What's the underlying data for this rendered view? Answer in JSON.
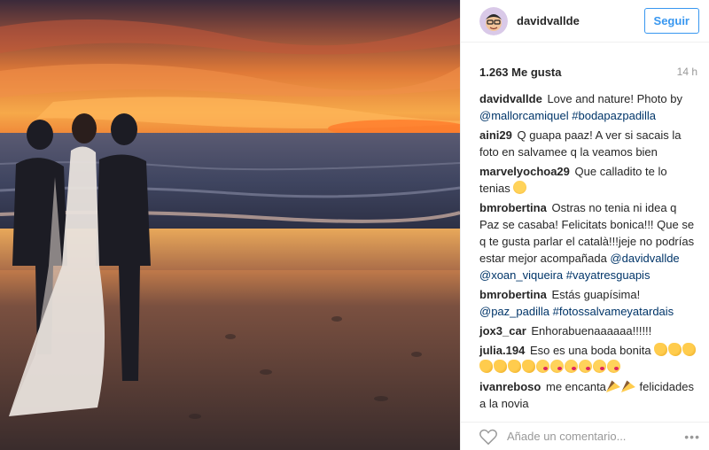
{
  "post": {
    "username": "davidvallde",
    "follow_label": "Seguir",
    "likes": "1.263 Me gusta",
    "time": "14 h"
  },
  "comments": [
    {
      "user": "davidvallde",
      "parts": [
        {
          "t": "text",
          "v": "Love and nature! Photo by "
        },
        {
          "t": "link",
          "v": "@mallorcamiquel"
        },
        {
          "t": "text",
          "v": " "
        },
        {
          "t": "link",
          "v": "#bodapazpadilla"
        }
      ]
    },
    {
      "user": "aini29",
      "parts": [
        {
          "t": "text",
          "v": "Q guapa paaz! A ver si sacais la foto en salvamee q la veamos bien"
        }
      ]
    },
    {
      "user": "marvelyochoa29",
      "parts": [
        {
          "t": "text",
          "v": "Que calladito te lo tenias "
        },
        {
          "t": "emoji",
          "v": "smile"
        }
      ]
    },
    {
      "user": "bmrobertina",
      "parts": [
        {
          "t": "text",
          "v": "Ostras no tenia ni idea q Paz se casaba! Felicitats bonica!!! Que se q te gusta parlar el català!!!jeje no podrías estar mejor acompañada "
        },
        {
          "t": "link",
          "v": "@davidvallde"
        },
        {
          "t": "text",
          "v": " "
        },
        {
          "t": "link",
          "v": "@xoan_viqueira"
        },
        {
          "t": "text",
          "v": " "
        },
        {
          "t": "link",
          "v": "#vayatresguapis"
        }
      ]
    },
    {
      "user": "bmrobertina",
      "parts": [
        {
          "t": "text",
          "v": "Estás guapísima! "
        },
        {
          "t": "link",
          "v": "@paz_padilla"
        },
        {
          "t": "text",
          "v": " "
        },
        {
          "t": "link",
          "v": "#fotossalvameyatardais"
        }
      ]
    },
    {
      "user": "jox3_car",
      "parts": [
        {
          "t": "text",
          "v": "Enhorabuenaaaaaa!!!!!!"
        }
      ]
    },
    {
      "user": "julia.194",
      "parts": [
        {
          "t": "text",
          "v": "Eso es una boda bonita "
        },
        {
          "t": "emoji",
          "v": "clap"
        },
        {
          "t": "emoji",
          "v": "clap"
        },
        {
          "t": "emoji",
          "v": "clap"
        },
        {
          "t": "emoji",
          "v": "clap"
        },
        {
          "t": "emoji",
          "v": "clap"
        },
        {
          "t": "emoji",
          "v": "clap"
        },
        {
          "t": "emoji",
          "v": "clap"
        },
        {
          "t": "emoji",
          "v": "kiss"
        },
        {
          "t": "emoji",
          "v": "kiss"
        },
        {
          "t": "emoji",
          "v": "kiss"
        },
        {
          "t": "emoji",
          "v": "kiss"
        },
        {
          "t": "emoji",
          "v": "kiss"
        },
        {
          "t": "emoji",
          "v": "kiss"
        }
      ]
    },
    {
      "user": "ivanreboso",
      "parts": [
        {
          "t": "text",
          "v": "me encanta"
        },
        {
          "t": "emoji",
          "v": "party"
        },
        {
          "t": "emoji",
          "v": "party"
        },
        {
          "t": "text",
          "v": " felicidades a la novia"
        }
      ]
    }
  ],
  "footer": {
    "comment_placeholder": "Añade un comentario...",
    "more_label": "•••"
  },
  "icons": {
    "avatar": "avatar-caricature",
    "like": "heart-icon",
    "more": "more-icon"
  },
  "colors": {
    "accent": "#3897f0",
    "link": "#003569"
  }
}
